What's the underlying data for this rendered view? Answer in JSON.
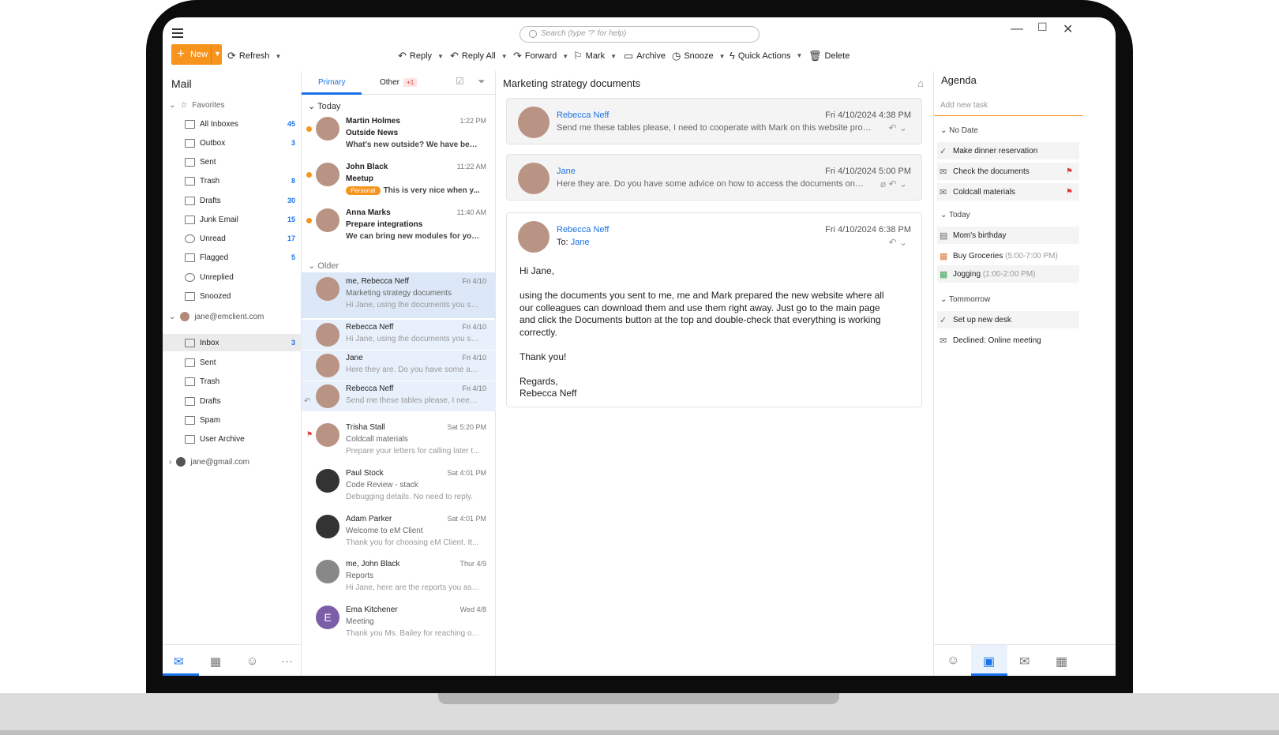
{
  "search": {
    "placeholder": "Search (type '?' for help)"
  },
  "toolbar": {
    "new": "New",
    "refresh": "Refresh",
    "reply": "Reply",
    "reply_all": "Reply All",
    "forward": "Forward",
    "mark": "Mark",
    "archive": "Archive",
    "snooze": "Snooze",
    "quick_actions": "Quick Actions",
    "delete": "Delete"
  },
  "sidebar": {
    "title": "Mail",
    "favorites": "Favorites",
    "fav_items": [
      {
        "label": "All Inboxes",
        "count": "45"
      },
      {
        "label": "Outbox",
        "count": "3"
      },
      {
        "label": "Sent",
        "count": ""
      },
      {
        "label": "Trash",
        "count": "8"
      },
      {
        "label": "Drafts",
        "count": "30"
      },
      {
        "label": "Junk Email",
        "count": "15"
      },
      {
        "label": "Unread",
        "count": "17"
      },
      {
        "label": "Flagged",
        "count": "5"
      },
      {
        "label": "Unreplied",
        "count": ""
      },
      {
        "label": "Snoozed",
        "count": ""
      }
    ],
    "account1": "jane@emclient.com",
    "acct_items": [
      {
        "label": "Inbox",
        "count": "3"
      },
      {
        "label": "Sent",
        "count": ""
      },
      {
        "label": "Trash",
        "count": ""
      },
      {
        "label": "Drafts",
        "count": ""
      },
      {
        "label": "Spam",
        "count": ""
      },
      {
        "label": "User Archive",
        "count": ""
      }
    ],
    "account2": "jane@gmail.com"
  },
  "list": {
    "tab_primary": "Primary",
    "tab_other": "Other",
    "other_badge": "+1",
    "group_today": "Today",
    "group_older": "Older",
    "personal_tag": "Personal",
    "messages": [
      {
        "from": "Martin Holmes",
        "date": "1:22 PM",
        "subject": "Outside News",
        "preview": "What's new outside? We have been..."
      },
      {
        "from": "John Black",
        "date": "11:22 AM",
        "subject": "Meetup",
        "preview": "This is very nice when y..."
      },
      {
        "from": "Anna Marks",
        "date": "11:40 AM",
        "subject": "Prepare integrations",
        "preview": "We can bring new modules for you..."
      },
      {
        "from": "me, Rebecca Neff",
        "date": "Fri 4/10",
        "subject": "Marketing strategy documents",
        "preview": "Hi Jane, using the documents you se..."
      },
      {
        "from": "Rebecca Neff",
        "date": "Fri 4/10",
        "subject": "",
        "preview": "Hi Jane, using the documents you se..."
      },
      {
        "from": "Jane",
        "date": "Fri 4/10",
        "subject": "",
        "preview": "Here they are. Do you have some adv..."
      },
      {
        "from": "Rebecca Neff",
        "date": "Fri 4/10",
        "subject": "",
        "preview": "Send me these tables please, I need t..."
      },
      {
        "from": "Trisha Stall",
        "date": "Sat 5:20 PM",
        "subject": "Coldcall materials",
        "preview": "Prepare your letters for calling later t..."
      },
      {
        "from": "Paul Stock",
        "date": "Sat 4:01 PM",
        "subject": "Code Review - stack",
        "preview": "Debugging details. No need to reply."
      },
      {
        "from": "Adam Parker",
        "date": "Sat 4:01 PM",
        "subject": "Welcome to eM Client",
        "preview": "Thank you for choosing eM Client. It..."
      },
      {
        "from": "me, John Black",
        "date": "Thur 4/9",
        "subject": "Reports",
        "preview": "Hi Jane, here are the reports you ask..."
      },
      {
        "from": "Ema Kitchener",
        "date": "Wed 4/8",
        "subject": "Meeting",
        "preview": "Thank you Ms. Bailey for reaching ou...",
        "initial": "E"
      }
    ]
  },
  "reader": {
    "title": "Marketing strategy documents",
    "cards": [
      {
        "name": "Rebecca Neff",
        "date": "Fri 4/10/2024 4:38 PM",
        "preview": "Send me these tables please, I need to cooperate with Mark on this website project..."
      },
      {
        "name": "Jane",
        "date": "Fri 4/10/2024 5:00 PM",
        "preview": "Here they are. Do you have some advice on how to access the documents once th..."
      },
      {
        "name": "Rebecca Neff",
        "date": "Fri 4/10/2024 6:38 PM",
        "to_label": "To:",
        "to": "Jane"
      }
    ],
    "body": {
      "greeting": "Hi Jane,",
      "p1": "using the documents you sent to me, me and Mark prepared the new website where all our colleagues can download them and use them right away. Just go to the main page and click the Documents button at the top and double-check that everything is working correctly.",
      "thanks": "Thank you!",
      "regards": "Regards,",
      "sig": "Rebecca Neff"
    }
  },
  "agenda": {
    "title": "Agenda",
    "add_placeholder": "Add new task",
    "g_nodate": "No Date",
    "g_today": "Today",
    "g_tomorrow": "Tommorrow",
    "items": [
      {
        "label": "Make dinner reservation",
        "extra": ""
      },
      {
        "label": "Check the documents",
        "extra": ""
      },
      {
        "label": "Coldcall materials",
        "extra": ""
      },
      {
        "label": "Mom's birthday",
        "extra": ""
      },
      {
        "label": "Buy Groceries",
        "extra": "(5:00-7:00 PM)"
      },
      {
        "label": "Jogging",
        "extra": "(1:00-2:00 PM)"
      },
      {
        "label": "Set up new desk",
        "extra": ""
      },
      {
        "label": "Declined: Online meeting",
        "extra": ""
      }
    ]
  },
  "colors": {
    "accent": "#1a73e8",
    "new_button": "#f7941e",
    "flag": "#e03a3a"
  }
}
